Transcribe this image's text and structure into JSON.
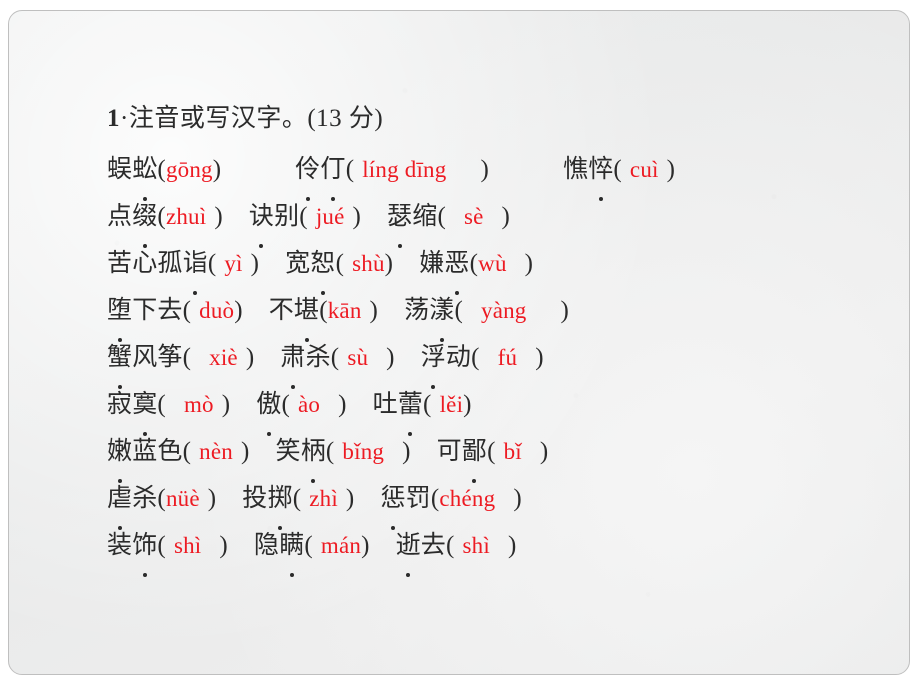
{
  "slide": {
    "background_color": "#eceded",
    "border_color": "#bfbfbf",
    "pinyin_color": "#ed1b23",
    "text_color": "#2b2b2b"
  },
  "question": {
    "number": "1",
    "separator": "·",
    "title": "注音或写汉字。",
    "score": "(13 分)"
  },
  "lines": [
    {
      "id": "line-1",
      "items": [
        {
          "word": "蜈蚣",
          "dotted_index": 1,
          "open": "(",
          "pinyin": "gōng",
          "close": ")",
          "pad_before": "",
          "pad_after": "",
          "gap_after": "gap-xl"
        },
        {
          "word": "伶仃",
          "dotted_index": "both",
          "open": "(",
          "pinyin": "líng dīng",
          "close": ")",
          "pad_before": "sp-in",
          "pad_after": "sp-in-xw",
          "gap_after": "gap-xl"
        },
        {
          "word": "憔悴",
          "dotted_index": 1,
          "open": "(",
          "pinyin": "cuì",
          "close": ")",
          "pad_before": "sp-in",
          "pad_after": "sp-in",
          "gap_after": ""
        }
      ]
    },
    {
      "id": "line-2",
      "items": [
        {
          "word": "点缀",
          "dotted_index": 1,
          "open": "(",
          "pinyin": "zhuì",
          "close": ")",
          "pad_before": "",
          "pad_after": "sp-in",
          "gap_after": "gap-m"
        },
        {
          "word": "诀别",
          "dotted_index": 0,
          "open": "(",
          "pinyin": "jué",
          "close": ")",
          "pad_before": "sp-in",
          "pad_after": "sp-in",
          "gap_after": "gap-m"
        },
        {
          "word": "瑟缩",
          "dotted_index": 0,
          "open": "(",
          "pinyin": "sè",
          "close": ")",
          "pad_before": "sp-in-w",
          "pad_after": "sp-in-w",
          "gap_after": ""
        }
      ]
    },
    {
      "id": "line-3",
      "items": [
        {
          "word": "苦心孤诣",
          "dotted_index": 3,
          "open": "(",
          "pinyin": "yì",
          "close": ")",
          "pad_before": "sp-in",
          "pad_after": "sp-in",
          "gap_after": "gap-m"
        },
        {
          "word": "宽恕",
          "dotted_index": 1,
          "open": "(",
          "pinyin": "shù",
          "close": ")",
          "pad_before": "sp-in",
          "pad_after": "",
          "gap_after": "gap-m"
        },
        {
          "word": "嫌恶",
          "dotted_index": 1,
          "open": "(",
          "pinyin": "wù",
          "close": ")",
          "pad_before": "",
          "pad_after": "sp-in-w",
          "gap_after": ""
        }
      ]
    },
    {
      "id": "line-4",
      "items": [
        {
          "word": "堕下去",
          "dotted_index": 0,
          "open": "(",
          "pinyin": "duò",
          "close": ")",
          "pad_before": "sp-in",
          "pad_after": "",
          "gap_after": "gap-m"
        },
        {
          "word": "不堪",
          "dotted_index": 1,
          "open": "(",
          "pinyin": "kān",
          "close": ")",
          "pad_before": "",
          "pad_after": "sp-in",
          "gap_after": "gap-m"
        },
        {
          "word": "荡漾",
          "dotted_index": 1,
          "open": "(",
          "pinyin": "yàng",
          "close": ")",
          "pad_before": "sp-in-w",
          "pad_after": "sp-in-xw",
          "gap_after": ""
        }
      ]
    },
    {
      "id": "line-5",
      "items": [
        {
          "word": "蟹风筝",
          "dotted_index": 0,
          "open": "(",
          "pinyin": "xiè",
          "close": ")",
          "pad_before": "sp-in-w",
          "pad_after": "sp-in",
          "gap_after": "gap-m"
        },
        {
          "word": "肃杀",
          "dotted_index": 0,
          "open": "(",
          "pinyin": "sù",
          "close": ")",
          "pad_before": "sp-in",
          "pad_after": "sp-in-w",
          "gap_after": "gap-m"
        },
        {
          "word": "浮动",
          "dotted_index": 0,
          "open": "(",
          "pinyin": "fú",
          "close": ")",
          "pad_before": "sp-in-w",
          "pad_after": "sp-in-w",
          "gap_after": ""
        }
      ]
    },
    {
      "id": "line-6",
      "items": [
        {
          "word": "寂寞",
          "dotted_index": 1,
          "open": "(",
          "pinyin": "mò",
          "close": ")",
          "pad_before": "sp-in-w",
          "pad_after": "sp-in",
          "gap_after": "gap-m"
        },
        {
          "word": "傲",
          "dotted_index": 0,
          "open": "(",
          "pinyin": "ào",
          "close": ")",
          "pad_before": "sp-in",
          "pad_after": "sp-in-w",
          "gap_after": "gap-m"
        },
        {
          "word": "吐蕾",
          "dotted_index": 1,
          "open": "(",
          "pinyin": "lěi",
          "close": ")",
          "pad_before": "sp-in",
          "pad_after": "",
          "gap_after": ""
        }
      ]
    },
    {
      "id": "line-7",
      "items": [
        {
          "word": "嫩蓝色",
          "dotted_index": 0,
          "open": "(",
          "pinyin": "nèn",
          "close": ")",
          "pad_before": "sp-in",
          "pad_after": "sp-in",
          "gap_after": "gap-m"
        },
        {
          "word": "笑柄",
          "dotted_index": 1,
          "open": "(",
          "pinyin": "bǐng",
          "close": ")",
          "pad_before": "sp-in",
          "pad_after": "sp-in-w",
          "gap_after": "gap-m"
        },
        {
          "word": "可鄙",
          "dotted_index": 1,
          "open": "(",
          "pinyin": "bǐ",
          "close": ")",
          "pad_before": "sp-in",
          "pad_after": "sp-in-w",
          "gap_after": ""
        }
      ]
    },
    {
      "id": "line-8",
      "items": [
        {
          "word": "虐杀",
          "dotted_index": 0,
          "open": "(",
          "pinyin": "nüè",
          "close": ")",
          "pad_before": "",
          "pad_after": "sp-in",
          "gap_after": "gap-m"
        },
        {
          "word": "投掷",
          "dotted_index": 1,
          "open": "(",
          "pinyin": "zhì",
          "close": ")",
          "pad_before": "sp-in",
          "pad_after": "sp-in",
          "gap_after": "gap-m"
        },
        {
          "word": "惩罚",
          "dotted_index": 0,
          "open": "(",
          "pinyin": "chéng",
          "close": ")",
          "pad_before": "",
          "pad_after": "sp-in-w",
          "gap_after": ""
        }
      ]
    },
    {
      "id": "line-9",
      "items": [
        {
          "word": "装饰",
          "dotted_index": 1,
          "open": "(",
          "pinyin": "shì",
          "close": ")",
          "pad_before": "sp-in",
          "pad_after": "sp-in-w",
          "gap_after": "gap-m"
        },
        {
          "word": "隐瞒",
          "dotted_index": 1,
          "open": "(",
          "pinyin": "mán",
          "close": ")",
          "pad_before": "sp-in",
          "pad_after": "",
          "gap_after": "gap-m"
        },
        {
          "word": "逝去",
          "dotted_index": 0,
          "open": "(",
          "pinyin": "shì",
          "close": ")",
          "pad_before": "sp-in",
          "pad_after": "sp-in-w",
          "gap_after": ""
        }
      ]
    }
  ]
}
